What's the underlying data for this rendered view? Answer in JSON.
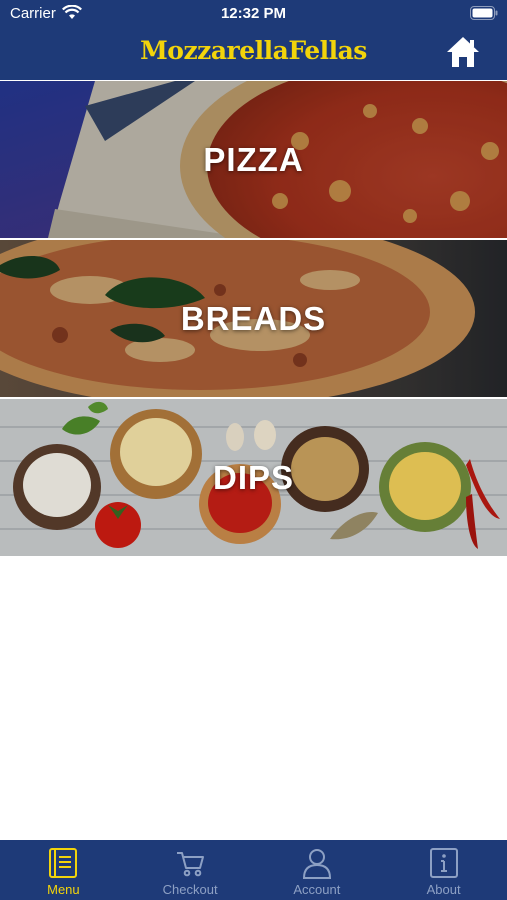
{
  "status_bar": {
    "carrier": "Carrier",
    "time": "12:32 PM"
  },
  "header": {
    "brand": "MozzarellaFellas",
    "home_icon": "home-icon"
  },
  "categories": [
    {
      "label": "PIZZA"
    },
    {
      "label": "BREADS"
    },
    {
      "label": "DIPS"
    }
  ],
  "tabbar": {
    "tabs": [
      {
        "label": "Menu",
        "icon": "menu-book-icon",
        "active": true
      },
      {
        "label": "Checkout",
        "icon": "cart-icon",
        "active": false
      },
      {
        "label": "Account",
        "icon": "user-icon",
        "active": false
      },
      {
        "label": "About",
        "icon": "info-icon",
        "active": false
      }
    ]
  },
  "colors": {
    "bar": "#1e3a78",
    "brand": "#f2d40b",
    "active_tab": "#f2d40b",
    "inactive_tab": "#8da0c4"
  }
}
